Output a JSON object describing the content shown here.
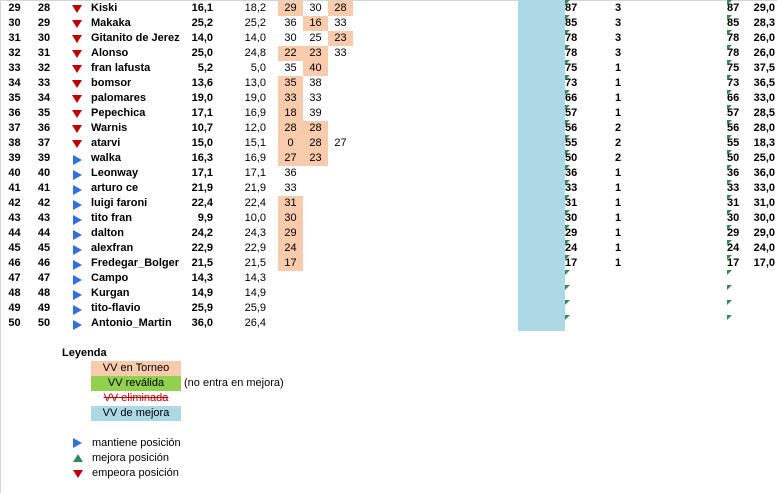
{
  "rows": [
    {
      "a": "29",
      "b": "28",
      "dir": "down",
      "name": "Kiski",
      "v1": "16,1",
      "v2": "18,2",
      "t1": "29",
      "t2": "30",
      "t3": "28",
      "hl": [
        1,
        0,
        1
      ],
      "c1": "87",
      "c2": "3",
      "c3": "87",
      "c4": "29,0"
    },
    {
      "a": "30",
      "b": "29",
      "dir": "down",
      "name": "Makaka",
      "v1": "25,2",
      "v2": "25,2",
      "t1": "36",
      "t2": "16",
      "t3": "33",
      "hl": [
        0,
        1,
        0
      ],
      "c1": "85",
      "c2": "3",
      "c3": "85",
      "c4": "28,3"
    },
    {
      "a": "31",
      "b": "30",
      "dir": "down",
      "name": "Gitanito de Jerez",
      "v1": "14,0",
      "v2": "14,0",
      "t1": "30",
      "t2": "25",
      "t3": "23",
      "hl": [
        0,
        0,
        1
      ],
      "c1": "78",
      "c2": "3",
      "c3": "78",
      "c4": "26,0"
    },
    {
      "a": "32",
      "b": "31",
      "dir": "down",
      "name": "Alonso",
      "v1": "25,0",
      "v2": "24,8",
      "t1": "22",
      "t2": "23",
      "t3": "33",
      "hl": [
        1,
        1,
        0
      ],
      "c1": "78",
      "c2": "3",
      "c3": "78",
      "c4": "26,0"
    },
    {
      "a": "33",
      "b": "32",
      "dir": "down",
      "name": "fran lafusta",
      "v1": "5,2",
      "v2": "5,0",
      "t1": "35",
      "t2": "40",
      "t3": "",
      "hl": [
        0,
        1,
        0
      ],
      "c1": "75",
      "c2": "1",
      "c3": "75",
      "c4": "37,5"
    },
    {
      "a": "34",
      "b": "33",
      "dir": "down",
      "name": "bomsor",
      "v1": "13,6",
      "v2": "13,0",
      "t1": "35",
      "t2": "38",
      "t3": "",
      "hl": [
        1,
        0,
        0
      ],
      "c1": "73",
      "c2": "1",
      "c3": "73",
      "c4": "36,5"
    },
    {
      "a": "35",
      "b": "34",
      "dir": "down",
      "name": "palomares",
      "v1": "19,0",
      "v2": "19,0",
      "t1": "33",
      "t2": "33",
      "t3": "",
      "hl": [
        1,
        0,
        0
      ],
      "c1": "66",
      "c2": "1",
      "c3": "66",
      "c4": "33,0"
    },
    {
      "a": "36",
      "b": "35",
      "dir": "down",
      "name": "Pepechica",
      "v1": "17,1",
      "v2": "16,9",
      "t1": "18",
      "t2": "39",
      "t3": "",
      "hl": [
        1,
        0,
        0
      ],
      "c1": "57",
      "c2": "1",
      "c3": "57",
      "c4": "28,5"
    },
    {
      "a": "37",
      "b": "36",
      "dir": "down",
      "name": "Warnis",
      "v1": "10,7",
      "v2": "12,0",
      "t1": "28",
      "t2": "28",
      "t3": "",
      "hl": [
        1,
        1,
        0
      ],
      "c1": "56",
      "c2": "2",
      "c3": "56",
      "c4": "28,0"
    },
    {
      "a": "38",
      "b": "37",
      "dir": "down",
      "name": "atarvi",
      "v1": "15,0",
      "v2": "15,1",
      "t1": "0",
      "t2": "28",
      "t3": "27",
      "hl": [
        1,
        1,
        0
      ],
      "c1": "55",
      "c2": "2",
      "c3": "55",
      "c4": "18,3"
    },
    {
      "a": "39",
      "b": "39",
      "dir": "right",
      "name": "walka",
      "v1": "16,3",
      "v2": "16,9",
      "t1": "27",
      "t2": "23",
      "t3": "",
      "hl": [
        1,
        1,
        0
      ],
      "c1": "50",
      "c2": "2",
      "c3": "50",
      "c4": "25,0"
    },
    {
      "a": "40",
      "b": "40",
      "dir": "right",
      "name": "Leonway",
      "v1": "17,1",
      "v2": "17,1",
      "t1": "36",
      "t2": "",
      "t3": "",
      "hl": [
        0,
        0,
        0
      ],
      "c1": "36",
      "c2": "1",
      "c3": "36",
      "c4": "36,0"
    },
    {
      "a": "41",
      "b": "41",
      "dir": "right",
      "name": "arturo ce",
      "v1": "21,9",
      "v2": "21,9",
      "t1": "33",
      "t2": "",
      "t3": "",
      "hl": [
        0,
        0,
        0
      ],
      "c1": "33",
      "c2": "1",
      "c3": "33",
      "c4": "33,0"
    },
    {
      "a": "42",
      "b": "42",
      "dir": "right",
      "name": "luigi faroni",
      "v1": "22,4",
      "v2": "22,4",
      "t1": "31",
      "t2": "",
      "t3": "",
      "hl": [
        1,
        0,
        0
      ],
      "c1": "31",
      "c2": "1",
      "c3": "31",
      "c4": "31,0"
    },
    {
      "a": "43",
      "b": "43",
      "dir": "right",
      "name": "tito fran",
      "v1": "9,9",
      "v2": "10,0",
      "t1": "30",
      "t2": "",
      "t3": "",
      "hl": [
        1,
        0,
        0
      ],
      "c1": "30",
      "c2": "1",
      "c3": "30",
      "c4": "30,0"
    },
    {
      "a": "44",
      "b": "44",
      "dir": "right",
      "name": "dalton",
      "v1": "24,2",
      "v2": "24,3",
      "t1": "29",
      "t2": "",
      "t3": "",
      "hl": [
        1,
        0,
        0
      ],
      "c1": "29",
      "c2": "1",
      "c3": "29",
      "c4": "29,0"
    },
    {
      "a": "45",
      "b": "45",
      "dir": "right",
      "name": "alexfran",
      "v1": "22,9",
      "v2": "22,9",
      "t1": "24",
      "t2": "",
      "t3": "",
      "hl": [
        1,
        0,
        0
      ],
      "c1": "24",
      "c2": "1",
      "c3": "24",
      "c4": "24,0"
    },
    {
      "a": "46",
      "b": "46",
      "dir": "right",
      "name": "Fredegar_Bolger",
      "v1": "21,5",
      "v2": "21,5",
      "t1": "17",
      "t2": "",
      "t3": "",
      "hl": [
        1,
        0,
        0
      ],
      "c1": "17",
      "c2": "1",
      "c3": "17",
      "c4": "17,0"
    },
    {
      "a": "47",
      "b": "47",
      "dir": "right",
      "name": "Campo",
      "v1": "14,3",
      "v2": "14,3",
      "t1": "",
      "t2": "",
      "t3": "",
      "hl": [
        0,
        0,
        0
      ],
      "c1": "",
      "c2": "",
      "c3": "",
      "c4": ""
    },
    {
      "a": "48",
      "b": "48",
      "dir": "right",
      "name": "Kurgan",
      "v1": "14,9",
      "v2": "14,9",
      "t1": "",
      "t2": "",
      "t3": "",
      "hl": [
        0,
        0,
        0
      ],
      "c1": "",
      "c2": "",
      "c3": "",
      "c4": ""
    },
    {
      "a": "49",
      "b": "49",
      "dir": "right",
      "name": "tito-flavio",
      "v1": "25,9",
      "v2": "25,9",
      "t1": "",
      "t2": "",
      "t3": "",
      "hl": [
        0,
        0,
        0
      ],
      "c1": "",
      "c2": "",
      "c3": "",
      "c4": ""
    },
    {
      "a": "50",
      "b": "50",
      "dir": "right",
      "name": "Antonio_Martin",
      "v1": "36,0",
      "v2": "26,4",
      "t1": "",
      "t2": "",
      "t3": "",
      "hl": [
        0,
        0,
        0
      ],
      "c1": "",
      "c2": "",
      "c3": "",
      "c4": ""
    }
  ],
  "legend": {
    "title": "Leyenda",
    "torneo": "VV en Torneo",
    "revalida": "VV reválida",
    "revalida_note": "(no entra en mejora)",
    "eliminada": "VV eliminada",
    "mejora": "VV de mejora",
    "mantiene": "mantiene posición",
    "mejora_pos": "mejora posición",
    "empeora": "empeora posición"
  },
  "colors": {
    "peach": "#f8cbad",
    "green": "#92d050",
    "blue": "#add8e6",
    "down": "#c00000",
    "right": "#2f6fe0",
    "up": "#2e8b57"
  }
}
